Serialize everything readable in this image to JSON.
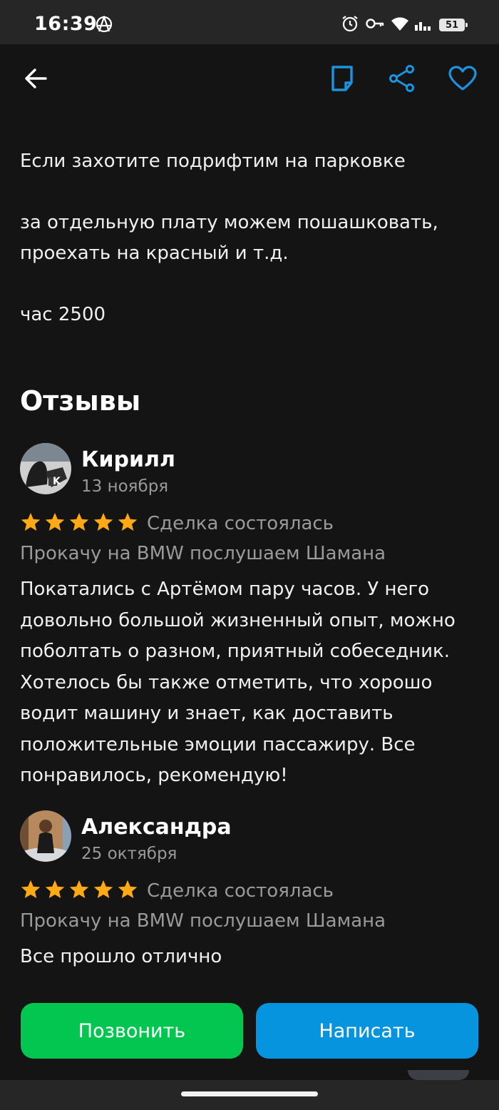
{
  "status_bar": {
    "time": "16:39",
    "battery": "51",
    "icons": [
      "anarchy-icon",
      "alarm-icon",
      "key-icon",
      "wifi-icon",
      "signal-icon",
      "battery-icon"
    ]
  },
  "toolbar": {
    "icons": [
      "back-arrow-icon",
      "note-icon",
      "share-icon",
      "heart-icon"
    ],
    "accent_color": "#1a94e0"
  },
  "description": {
    "paragraphs": [
      "Если захотите подрифтим на парковке",
      "за отдельную плату можем пошашковать, проехать на красный и т.д.",
      "час 2500"
    ]
  },
  "reviews": {
    "title": "Отзывы",
    "items": [
      {
        "name": "Кирилл",
        "date": "13 ноября",
        "rating": 5,
        "status": "Сделка состоялась",
        "item": "Прокачу на BMW послушаем Шамана",
        "text": "Покатались с Артёмом пару часов. У него довольно большой жизненный опыт, можно поболтать о разном, приятный собеседник. Хотелось бы также отметить, что хорошо водит машину и знает, как доставить положительные эмоции пассажиру. Все понравилось, рекомендую!"
      },
      {
        "name": "Александра",
        "date": "25 октября",
        "rating": 5,
        "status": "Сделка состоялась",
        "item": "Прокачу на BMW послушаем Шамана",
        "text": "Все прошло отлично"
      }
    ],
    "star_color": "#ffa914"
  },
  "actions": {
    "call_label": "Позвонить",
    "write_label": "Написать",
    "call_color": "#02c650",
    "write_color": "#0694df"
  }
}
